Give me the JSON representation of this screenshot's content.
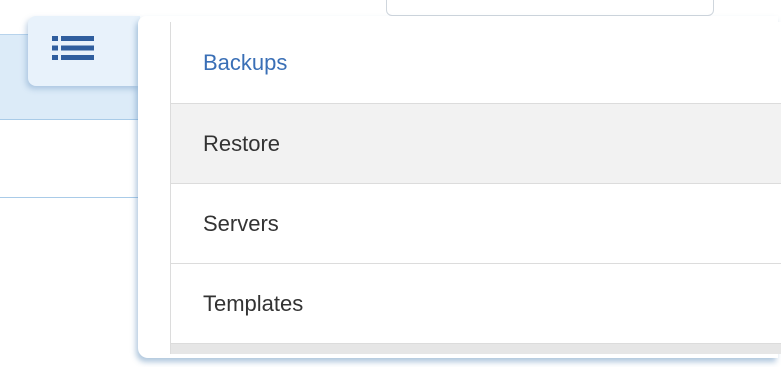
{
  "colors": {
    "accent": "#3a6fb6",
    "hover_bg": "#f2f2f2",
    "toggle_bg": "#e8f2fb",
    "band_bg": "#dcebf8"
  },
  "menu_toggle": {
    "icon": "list-icon"
  },
  "menu": {
    "items": [
      {
        "label": "Backups",
        "state": "active"
      },
      {
        "label": "Restore",
        "state": "hover"
      },
      {
        "label": "Servers",
        "state": "default"
      },
      {
        "label": "Templates",
        "state": "default"
      }
    ]
  }
}
